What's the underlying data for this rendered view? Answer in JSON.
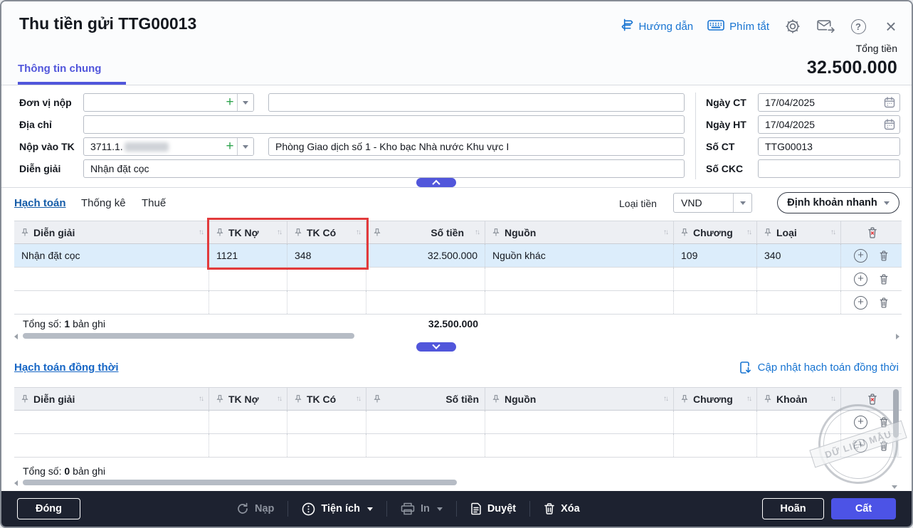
{
  "window": {
    "title": "Thu tiền gửi TTG00013"
  },
  "header": {
    "guide_link": "Hướng dẫn",
    "shortcut_link": "Phím tắt",
    "total_label": "Tổng tiền",
    "total_value": "32.500.000"
  },
  "tabs": {
    "general": "Thông tin chung"
  },
  "form": {
    "don_vi_nop": {
      "label": "Đơn vị nộp",
      "code": "",
      "name": ""
    },
    "dia_chi": {
      "label": "Địa chỉ",
      "value": ""
    },
    "nop_vao_tk": {
      "label": "Nộp vào TK",
      "code": "3711.1.",
      "name": "Phòng Giao dịch số 1 - Kho bạc Nhà nước Khu vực I"
    },
    "dien_giai": {
      "label": "Diễn giải",
      "value": "Nhận đặt cọc"
    },
    "ngay_ct": {
      "label": "Ngày CT",
      "value": "17/04/2025"
    },
    "ngay_ht": {
      "label": "Ngày HT",
      "value": "17/04/2025"
    },
    "so_ct": {
      "label": "Số CT",
      "value": "TTG00013"
    },
    "so_ckc": {
      "label": "Số CKC",
      "value": ""
    }
  },
  "accounting": {
    "tab_hach_toan": "Hạch toán",
    "tab_thong_ke": "Thống kê",
    "tab_thue": "Thuế",
    "currency_label": "Loại tiền",
    "currency_value": "VND",
    "quick_entry": "Định khoản nhanh",
    "columns": {
      "c0": "Diễn giải",
      "c1": "TK Nợ",
      "c2": "TK Có",
      "c3": "Số tiền",
      "c4": "Nguồn",
      "c5": "Chương",
      "c6": "Loại"
    },
    "row1": {
      "dien_giai": "Nhận đặt cọc",
      "tk_no": "1121",
      "tk_co": "348",
      "so_tien": "32.500.000",
      "nguon": "Nguồn khác",
      "chuong": "109",
      "loai": "340"
    },
    "footer": {
      "label": "Tổng số:",
      "count": "1",
      "suffix": "bản ghi",
      "total": "32.500.000"
    }
  },
  "simultaneous": {
    "title": "Hạch toán đồng thời",
    "update_link": "Cập nhật hạch toán đồng thời",
    "columns": {
      "c0": "Diễn giải",
      "c1": "TK Nợ",
      "c2": "TK Có",
      "c3": "Số tiền",
      "c4": "Nguồn",
      "c5": "Chương",
      "c6": "Khoản"
    },
    "footer": {
      "label": "Tổng số:",
      "count": "0",
      "suffix": "bản ghi"
    },
    "watermark": "DỮ LIỆU MẪU"
  },
  "toolbar": {
    "dong": "Đóng",
    "nap": "Nạp",
    "tien_ich": "Tiện ích",
    "in": "In",
    "duyet": "Duyệt",
    "xoa": "Xóa",
    "hoan": "Hoãn",
    "cat": "Cất"
  },
  "colors": {
    "accent": "#5156DB",
    "link": "#1673D1",
    "highlight_red": "#E23A3C",
    "row_highlight": "#DCEDFB",
    "toolbar_bg": "#1D2230"
  }
}
